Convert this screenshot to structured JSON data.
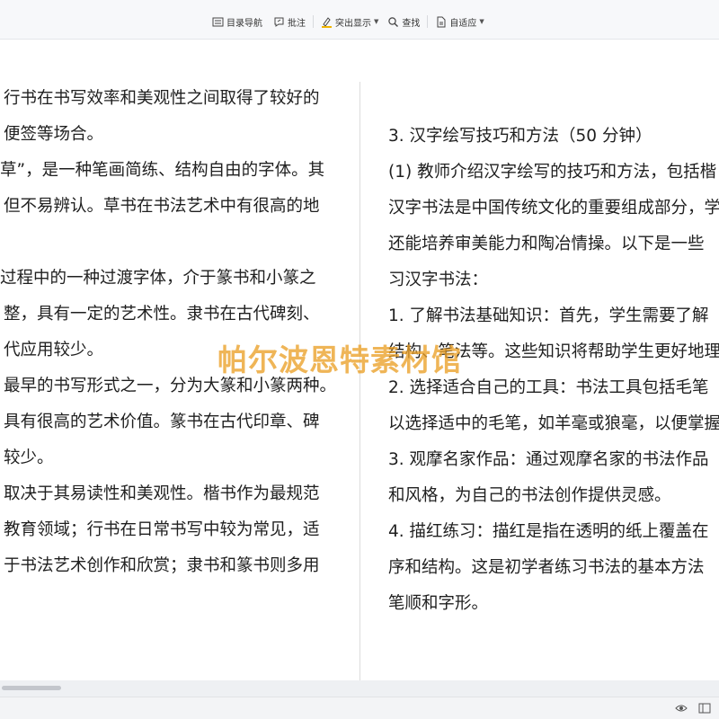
{
  "toolbar": {
    "nav_label": "目录导航",
    "comment_label": "批注",
    "highlight_label": "突出显示",
    "search_label": "查找",
    "fit_label": "自适应"
  },
  "left_column": {
    "lines": [
      "行书在书写效率和美观性之间取得了较好的",
      "便签等场合。",
      "草”，是一种笔画简练、结构自由的字体。其",
      "但不易辨认。草书在书法艺术中有很高的地",
      "",
      "过程中的一种过渡字体，介于篆书和小篆之",
      "整，具有一定的艺术性。隶书在古代碑刻、",
      "代应用较少。",
      "最早的书写形式之一，分为大篆和小篆两种。",
      "具有很高的艺术价值。篆书在古代印章、碑",
      "较少。",
      "取决于其易读性和美观性。楷书作为最规范",
      "教育领域；行书在日常书写中较为常见，适",
      "于书法艺术创作和欣赏；隶书和篆书则多用"
    ]
  },
  "right_column": {
    "lines": [
      "3. 汉字绘写技巧和方法（50 分钟）",
      "(1) 教师介绍汉字绘写的技巧和方法，包括楷",
      "汉字书法是中国传统文化的重要组成部分，学",
      "还能培养审美能力和陶冶情操。以下是一些",
      "习汉字书法：",
      "1. 了解书法基础知识：首先，学生需要了解",
      "结构、笔法等。这些知识将帮助学生更好地理",
      "2. 选择适合自己的工具：书法工具包括毛笔",
      "以选择适中的毛笔，如羊毫或狼毫，以便掌握",
      "3. 观摩名家作品：通过观摩名家的书法作品",
      "和风格，为自己的书法创作提供灵感。",
      "4. 描红练习：描红是指在透明的纸上覆盖在",
      "序和结构。这是初学者练习书法的基本方法",
      "笔顺和字形。"
    ]
  },
  "watermark": "帕尔波恩特素材馆",
  "colors": {
    "watermark": "#eba028",
    "toolbar_bg": "#f7f8fa",
    "accent_highlight": "#f0b400"
  }
}
